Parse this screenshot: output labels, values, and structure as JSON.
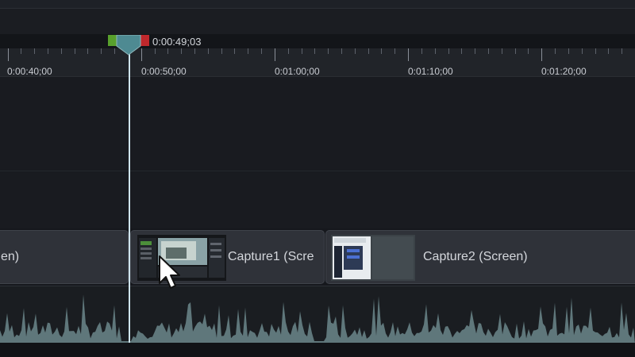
{
  "playhead": {
    "time": "0:00:49;03",
    "start_marker_color": "#58a02c",
    "end_marker_color": "#c0282c"
  },
  "ruler": {
    "labels": [
      "0:00:40;00",
      "0:00:50;00",
      "0:01:00;00",
      "0:01:10;00",
      "0:01:20;00"
    ]
  },
  "clips": [
    {
      "title": "en)"
    },
    {
      "title": "Capture1 (Scre"
    },
    {
      "title": "Capture2 (Screen)"
    }
  ],
  "colors": {
    "waveform": "#5f777b",
    "playhead": "#cfe5ee",
    "background": "#16181d"
  },
  "icons": {
    "cursor": "mouse-pointer-icon"
  }
}
